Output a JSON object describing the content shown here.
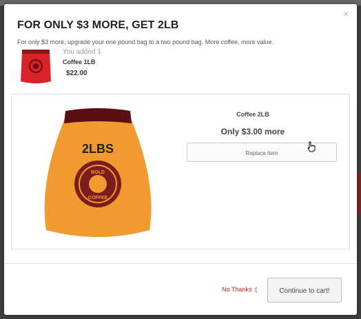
{
  "modal": {
    "close_icon": "×",
    "title": "FOR ONLY $3 MORE, GET 2LB",
    "subtitle": "For only $3 more, upgrade your one pound bag to a two pound bag. More coffee, more value."
  },
  "added_item": {
    "label": "You added 1",
    "name": "Coffee 1LB",
    "price": "$22.00",
    "image_icon": "coffee-bag-red"
  },
  "offer": {
    "name": "Coffee 2LB",
    "price_text": "Only $3.00 more",
    "replace_label": "Replace Item",
    "image_icon": "coffee-bag-orange",
    "bag_label": "2LBS",
    "logo_top": "BOLD",
    "logo_bottom": "COFFEE"
  },
  "footer": {
    "no_thanks_label": "No Thanks :(",
    "continue_label": "Continue to cart!"
  },
  "colors": {
    "accent_red": "#d02020",
    "bag_orange": "#f09a2f",
    "bag_red": "#d9232a",
    "logo_maroon": "#7a1d1d"
  }
}
